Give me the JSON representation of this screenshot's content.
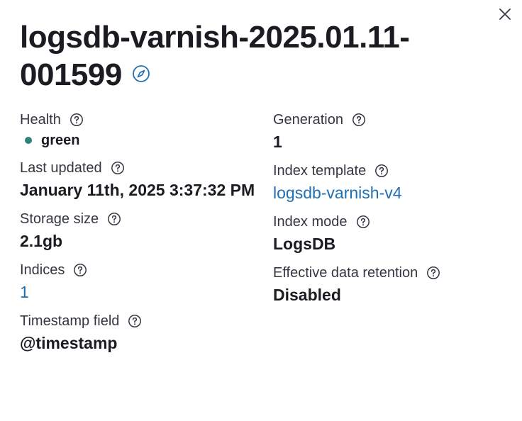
{
  "flyout": {
    "title": "logsdb-varnish-2025.01.11-001599",
    "title_icon": "compass-icon",
    "close_icon": "close-icon"
  },
  "left_fields": {
    "health": {
      "label": "Health",
      "value": "green",
      "status_color": "#2f8377"
    },
    "last_updated": {
      "label": "Last updated",
      "value": "January 11th, 2025 3:37:32 PM"
    },
    "storage_size": {
      "label": "Storage size",
      "value": "2.1gb"
    },
    "indices": {
      "label": "Indices",
      "value": "1"
    },
    "timestamp_field": {
      "label": "Timestamp field",
      "value": "@timestamp"
    }
  },
  "right_fields": {
    "generation": {
      "label": "Generation",
      "value": "1"
    },
    "index_template": {
      "label": "Index template",
      "value": "logsdb-varnish-v4"
    },
    "index_mode": {
      "label": "Index mode",
      "value": "LogsDB"
    },
    "data_retention": {
      "label": "Effective data retention",
      "value": "Disabled"
    }
  },
  "colors": {
    "link": "#1f6fb3",
    "text": "#1a1c21",
    "label": "#343741",
    "icon": "#343741",
    "accent_icon": "#1f6fb3"
  }
}
